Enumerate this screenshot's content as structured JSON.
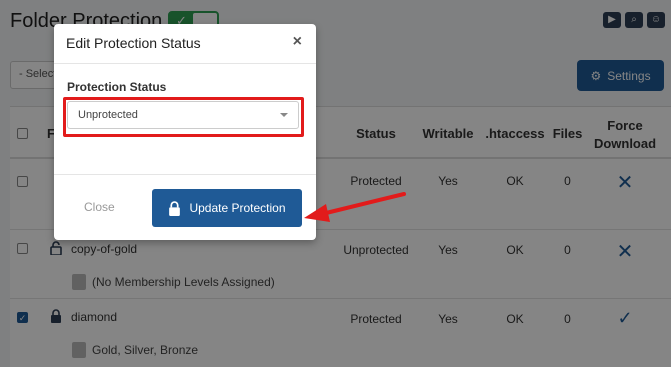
{
  "header": {
    "title": "Folder Protection",
    "toggle_icon": "check-icon",
    "top_icons": [
      "video-icon",
      "search-icon",
      "user-icon"
    ]
  },
  "toolbar": {
    "select_placeholder": "- Select",
    "settings_label": "Settings"
  },
  "table": {
    "columns": {
      "folder": "F",
      "status": "Status",
      "writable": "Writable",
      "htaccess": ".htaccess",
      "files": "Files",
      "force_download": "Force\nDownload"
    },
    "rows": [
      {
        "name": "",
        "status": "Protected",
        "writable": "Yes",
        "htaccess": "OK",
        "files": "0",
        "force_download": "x",
        "levels": ""
      },
      {
        "name": "copy-of-gold",
        "status": "Unprotected",
        "writable": "Yes",
        "htaccess": "OK",
        "files": "0",
        "force_download": "x",
        "levels": "(No Membership Levels Assigned)"
      },
      {
        "name": "diamond",
        "status": "Protected",
        "writable": "Yes",
        "htaccess": "OK",
        "files": "0",
        "force_download": "check",
        "levels": "Gold, Silver, Bronze"
      }
    ]
  },
  "modal": {
    "title": "Edit Protection Status",
    "close_symbol": "×",
    "field_label": "Protection Status",
    "selected_value": "Unprotected",
    "close_button": "Close",
    "update_button": "Update Protection"
  },
  "colors": {
    "accent": "#1f5a96",
    "highlight": "#e21b1b",
    "toggle": "#2e9f53"
  }
}
